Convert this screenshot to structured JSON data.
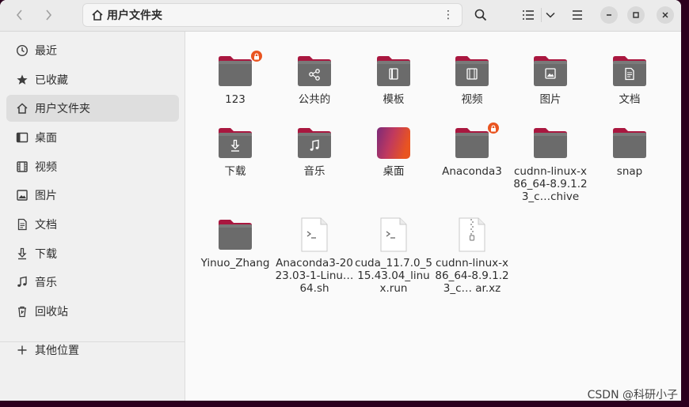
{
  "header": {
    "path_label": "用户文件夹"
  },
  "sidebar": {
    "items": [
      {
        "label": "最近",
        "icon": "clock-icon"
      },
      {
        "label": "已收藏",
        "icon": "star-icon"
      },
      {
        "label": "用户文件夹",
        "icon": "home-icon",
        "active": true
      },
      {
        "label": "桌面",
        "icon": "desktop-icon"
      },
      {
        "label": "视频",
        "icon": "video-icon"
      },
      {
        "label": "图片",
        "icon": "picture-icon"
      },
      {
        "label": "文档",
        "icon": "document-icon"
      },
      {
        "label": "下载",
        "icon": "download-icon"
      },
      {
        "label": "音乐",
        "icon": "music-icon"
      },
      {
        "label": "回收站",
        "icon": "trash-icon"
      },
      {
        "label": "其他位置",
        "icon": "plus-icon"
      }
    ]
  },
  "files": [
    {
      "name": "123",
      "kind": "folder",
      "emblem": "",
      "locked": true
    },
    {
      "name": "公共的",
      "kind": "folder",
      "emblem": "share",
      "locked": false
    },
    {
      "name": "模板",
      "kind": "folder",
      "emblem": "template",
      "locked": false
    },
    {
      "name": "视频",
      "kind": "folder",
      "emblem": "video",
      "locked": false
    },
    {
      "name": "图片",
      "kind": "folder",
      "emblem": "picture",
      "locked": false
    },
    {
      "name": "文档",
      "kind": "folder",
      "emblem": "document",
      "locked": false
    },
    {
      "name": "下载",
      "kind": "folder",
      "emblem": "download",
      "locked": false
    },
    {
      "name": "音乐",
      "kind": "folder",
      "emblem": "music",
      "locked": false
    },
    {
      "name": "桌面",
      "kind": "desktop",
      "emblem": "",
      "locked": false
    },
    {
      "name": "Anaconda3",
      "kind": "folder",
      "emblem": "",
      "locked": true
    },
    {
      "name": "cudnn-linux-x86_64-8.9.1.23_c…chive",
      "kind": "folder",
      "emblem": "",
      "locked": false
    },
    {
      "name": "snap",
      "kind": "folder",
      "emblem": "",
      "locked": false
    },
    {
      "name": "Yinuo_Zhang",
      "kind": "folder",
      "emblem": "",
      "locked": false
    },
    {
      "name": "Anaconda3-2023.03-1-Linu… 64.sh",
      "kind": "script",
      "emblem": "",
      "locked": false
    },
    {
      "name": "cuda_11.7.0_515.43.04_linux.run",
      "kind": "script",
      "emblem": "",
      "locked": false
    },
    {
      "name": "cudnn-linux-x86_64-8.9.1.23_c… ar.xz",
      "kind": "archive",
      "emblem": "",
      "locked": false
    }
  ],
  "watermark": "CSDN @科研小子",
  "colors": {
    "folder_top": "#a9173f",
    "folder_body": "#6b6b6b",
    "accent": "#e95420"
  }
}
